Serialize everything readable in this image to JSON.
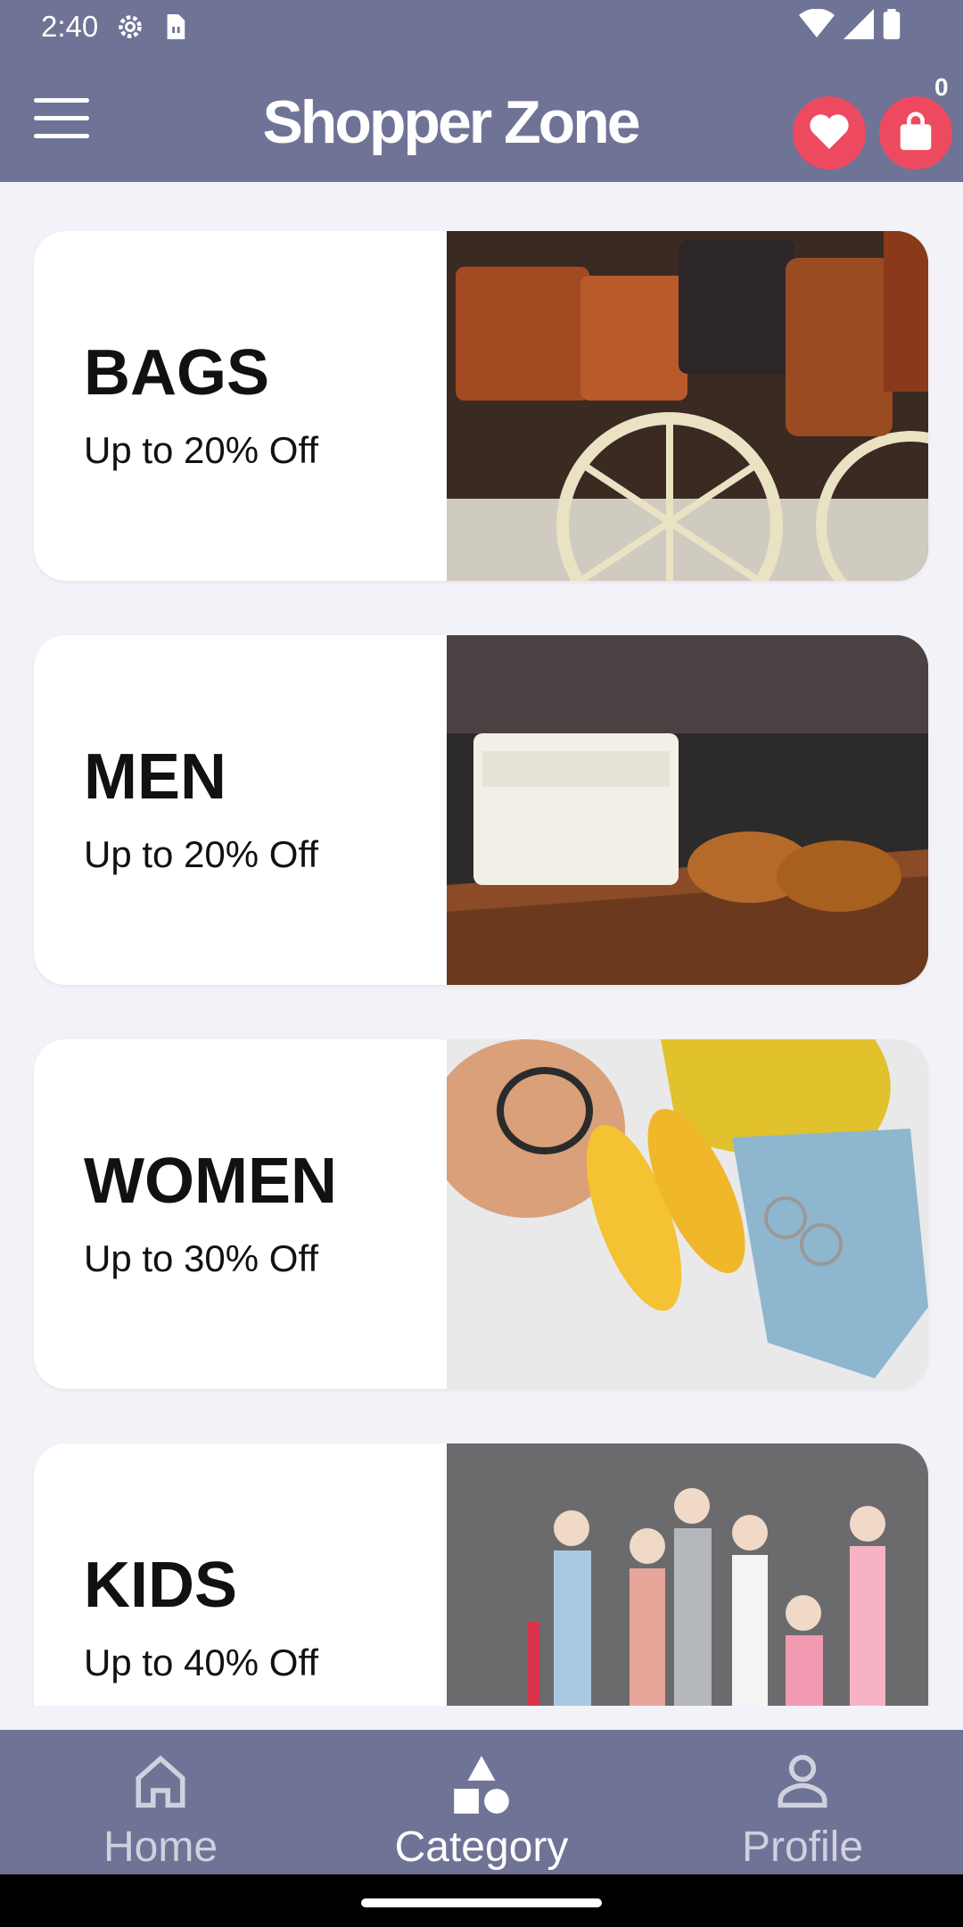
{
  "status_bar": {
    "time": "2:40",
    "icons": [
      "settings-icon",
      "sim-card-icon",
      "wifi-icon",
      "signal-icon",
      "battery-icon"
    ]
  },
  "app_bar": {
    "title": "Shopper Zone",
    "menu_icon": "hamburger-menu-icon",
    "wishlist_icon": "heart-icon",
    "cart_icon": "shopping-bag-icon",
    "cart_count": "0",
    "accent_color": "#ee4a5f",
    "bar_color": "#6f7396"
  },
  "categories": [
    {
      "title": "BAGS",
      "subtitle": "Up to 20% Off"
    },
    {
      "title": "MEN",
      "subtitle": "Up to 20% Off"
    },
    {
      "title": "WOMEN",
      "subtitle": "Up to 30% Off"
    },
    {
      "title": "KIDS",
      "subtitle": "Up to 40% Off"
    }
  ],
  "bottom_nav": {
    "items": [
      {
        "label": "Home",
        "icon": "home-icon",
        "active": false
      },
      {
        "label": "Category",
        "icon": "category-shapes-icon",
        "active": true
      },
      {
        "label": "Profile",
        "icon": "person-icon",
        "active": false
      }
    ]
  }
}
